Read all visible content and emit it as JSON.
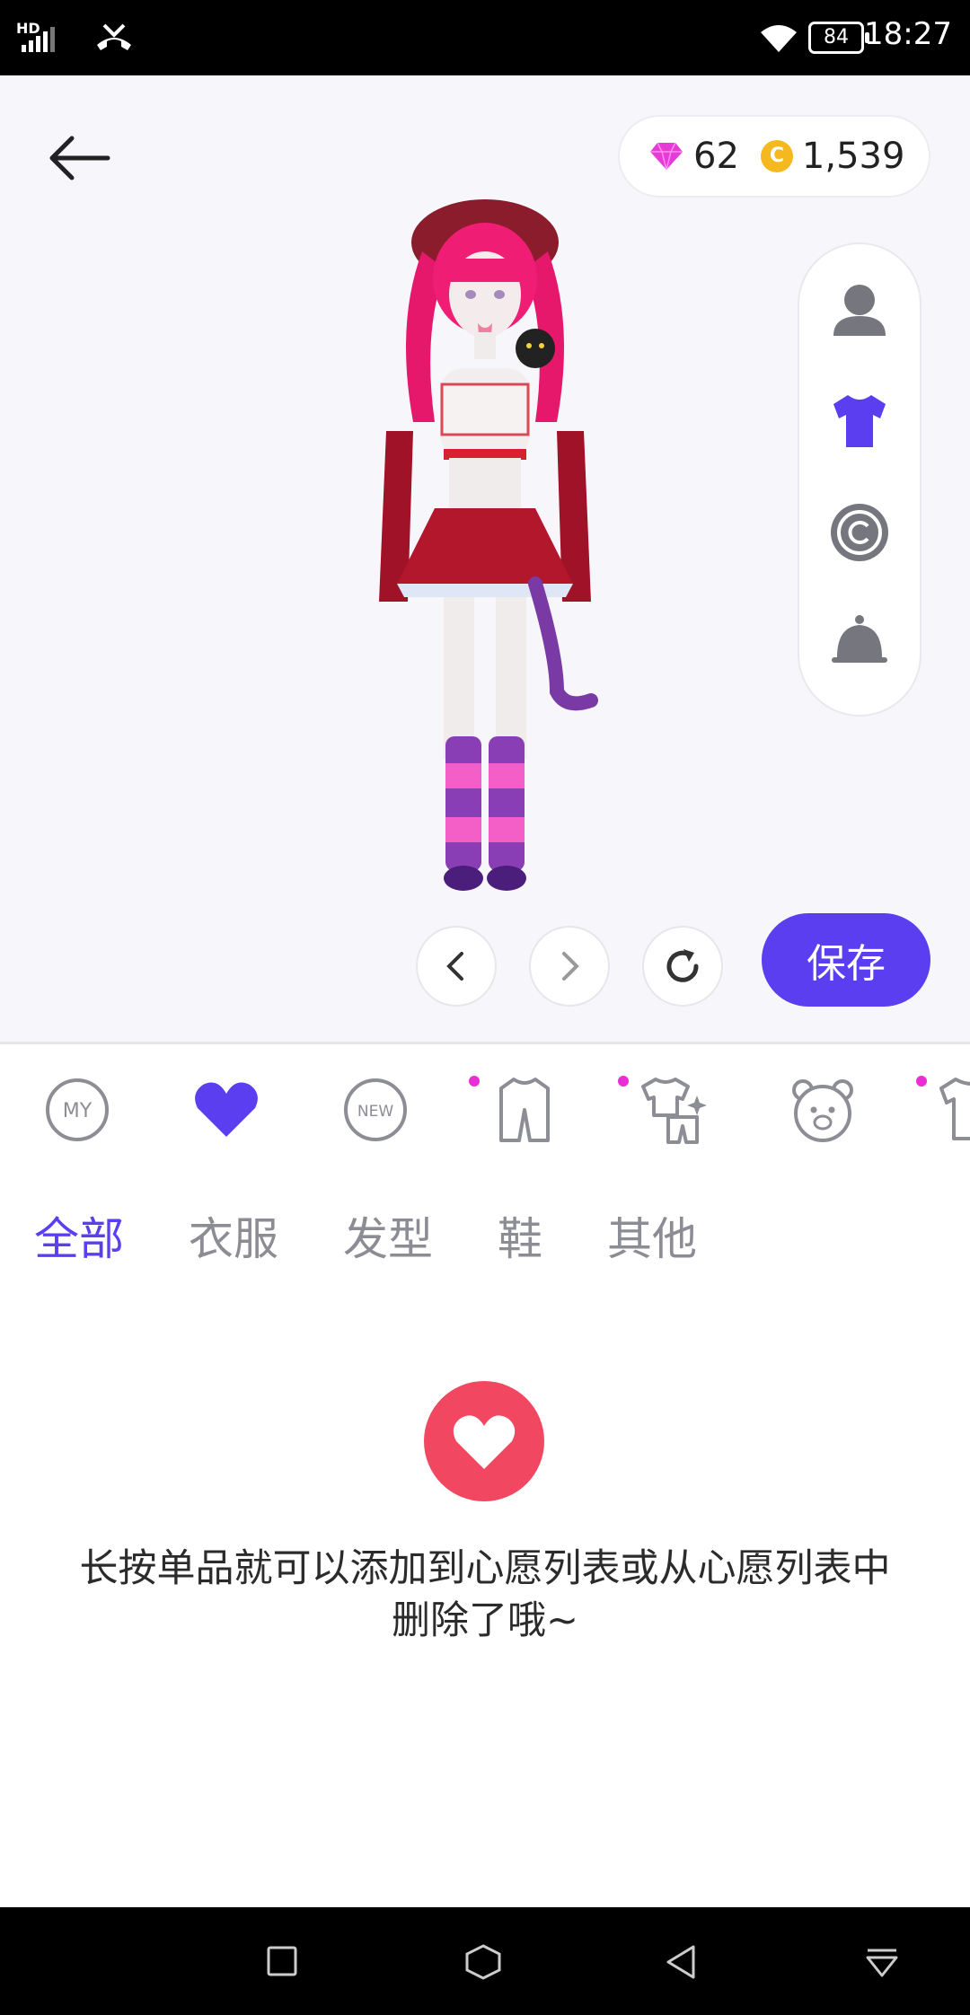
{
  "status_bar": {
    "network": "HD",
    "battery": "84",
    "time": "18:27"
  },
  "currency": {
    "gems": "62",
    "coins": "1,539",
    "gem_color": "#e83ad6",
    "coin_color": "#f5b81f",
    "coin_symbol": "C"
  },
  "side_panel": {
    "items": [
      "person-icon",
      "shirt-icon",
      "copyright-icon",
      "bell-icon"
    ],
    "active": "shirt-icon"
  },
  "controls": {
    "save_label": "保存"
  },
  "categories": {
    "items": [
      "my-icon",
      "heart-icon",
      "new-icon",
      "outfit-icon",
      "outfit-set-icon",
      "bear-icon",
      "tshirt-icon"
    ],
    "my_label": "MY",
    "new_label": "NEW",
    "active": "heart-icon"
  },
  "tabs": {
    "items": [
      "全部",
      "衣服",
      "发型",
      "鞋",
      "其他"
    ],
    "active_index": 0
  },
  "empty_state": {
    "message": "长按单品就可以添加到心愿列表或从心愿列表中删除了哦~"
  },
  "colors": {
    "accent": "#5a3ef0",
    "heart": "#f24760",
    "badge_dot": "#e92fd3"
  }
}
